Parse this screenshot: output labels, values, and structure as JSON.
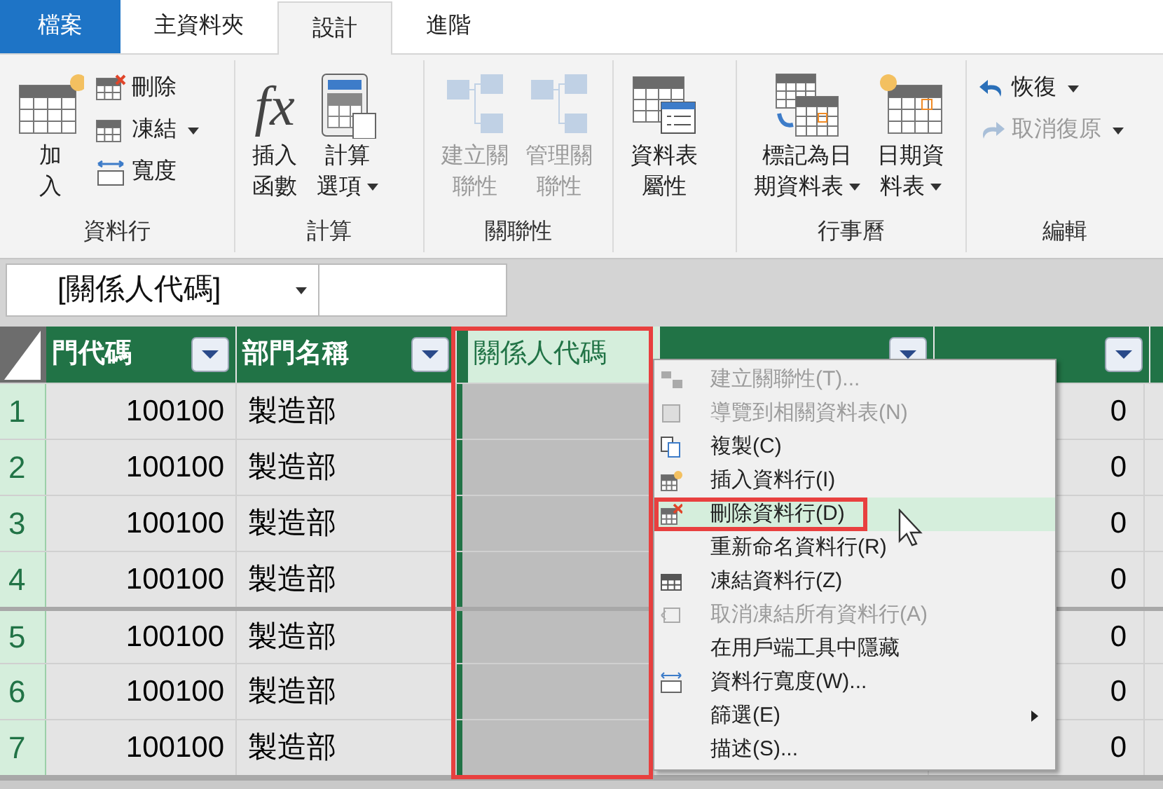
{
  "tabs": [
    {
      "label": "檔案",
      "kind": "file",
      "selected": false
    },
    {
      "label": "主資料夾",
      "kind": "tab",
      "selected": false
    },
    {
      "label": "設計",
      "kind": "tab",
      "selected": true
    },
    {
      "label": "進階",
      "kind": "tab",
      "selected": false
    }
  ],
  "ribbon": {
    "groups": [
      {
        "label": "資料行",
        "buttons": [
          {
            "kind": "large",
            "lines": [
              "加",
              "入"
            ],
            "disabled": false,
            "dropdown": false
          },
          {
            "kind": "small",
            "lines": [
              "刪除"
            ],
            "disabled": false,
            "dropdown": false
          },
          {
            "kind": "small",
            "lines": [
              "凍結"
            ],
            "disabled": false,
            "dropdown": true
          },
          {
            "kind": "small",
            "lines": [
              "寬度"
            ],
            "disabled": false,
            "dropdown": false
          }
        ]
      },
      {
        "label": "計算",
        "buttons": [
          {
            "kind": "large",
            "icon_text": "fx",
            "lines": [
              "插入",
              "函數"
            ],
            "disabled": false,
            "dropdown": false
          },
          {
            "kind": "large",
            "lines": [
              "計算",
              "選項"
            ],
            "disabled": false,
            "dropdown": true
          }
        ]
      },
      {
        "label": "關聯性",
        "buttons": [
          {
            "kind": "large",
            "lines": [
              "建立關",
              "聯性"
            ],
            "disabled": true,
            "dropdown": false
          },
          {
            "kind": "large",
            "lines": [
              "管理關",
              "聯性"
            ],
            "disabled": true,
            "dropdown": false
          }
        ]
      },
      {
        "buttons": [
          {
            "kind": "large",
            "lines": [
              "資料表",
              "屬性"
            ],
            "disabled": false,
            "dropdown": false
          }
        ]
      },
      {
        "label": "行事曆",
        "buttons": [
          {
            "kind": "large",
            "lines": [
              "標記為日",
              "期資料表"
            ],
            "disabled": false,
            "dropdown": true
          },
          {
            "kind": "large",
            "lines": [
              "日期資",
              "料表"
            ],
            "disabled": false,
            "dropdown": true
          }
        ]
      },
      {
        "label": "編輯",
        "buttons": [
          {
            "kind": "small",
            "lines": [
              "恢復"
            ],
            "disabled": false,
            "dropdown": true
          },
          {
            "kind": "small",
            "lines": [
              "取消復原"
            ],
            "disabled": true,
            "dropdown": true
          }
        ]
      }
    ]
  },
  "name_box": {
    "value": "[關係人代碼]"
  },
  "grid": {
    "columns": [
      {
        "label": "門代碼",
        "selected": false
      },
      {
        "label": "部門名稱",
        "selected": false
      },
      {
        "label": "關係人代碼",
        "selected": true,
        "annotated": true
      },
      {
        "selected": false
      },
      {
        "selected": false
      }
    ],
    "rows": [
      {
        "number": "1",
        "code": "100100",
        "name": "製造部",
        "amount": "0"
      },
      {
        "number": "2",
        "code": "100100",
        "name": "製造部",
        "amount": "0"
      },
      {
        "number": "3",
        "code": "100100",
        "name": "製造部",
        "amount": "0"
      },
      {
        "number": "4",
        "code": "100100",
        "name": "製造部",
        "amount": "0"
      },
      {
        "number": "5",
        "code": "100100",
        "name": "製造部",
        "amount": "0"
      },
      {
        "number": "6",
        "code": "100100",
        "name": "製造部",
        "amount": "0"
      },
      {
        "number": "7",
        "code": "100100",
        "name": "製造部",
        "amount": "0"
      }
    ]
  },
  "context_menu": {
    "items": [
      {
        "label": "建立關聯性(T)...",
        "kind": "relate",
        "disabled": true,
        "selected": false
      },
      {
        "label": "導覽到相關資料表(N)",
        "kind": "navigate",
        "disabled": true,
        "selected": false
      },
      {
        "label": "複製(C)",
        "kind": "copy",
        "disabled": false,
        "selected": false
      },
      {
        "label": "插入資料行(I)",
        "kind": "insert",
        "disabled": false,
        "selected": false
      },
      {
        "label": "刪除資料行(D)",
        "kind": "delete",
        "disabled": false,
        "selected": true,
        "annotated": true
      },
      {
        "label": "重新命名資料行(R)",
        "kind": "plain",
        "disabled": false,
        "selected": false
      },
      {
        "label": "凍結資料行(Z)",
        "kind": "freeze",
        "disabled": false,
        "selected": false
      },
      {
        "label": "取消凍結所有資料行(A)",
        "kind": "unfreeze",
        "disabled": true,
        "selected": false
      },
      {
        "label": "在用戶端工具中隱藏",
        "kind": "plain",
        "disabled": false,
        "selected": false
      },
      {
        "label": "資料行寬度(W)...",
        "kind": "width",
        "disabled": false,
        "selected": false
      },
      {
        "label": "篩選(E)",
        "kind": "submenu",
        "disabled": false,
        "selected": false
      },
      {
        "label": "描述(S)...",
        "kind": "plain",
        "disabled": false,
        "selected": false
      }
    ]
  }
}
